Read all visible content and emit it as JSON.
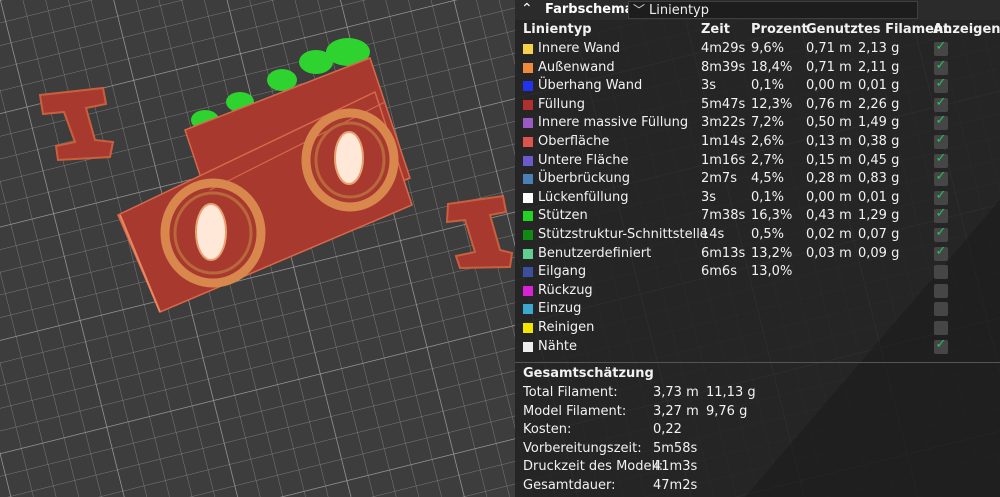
{
  "header": {
    "title": "Farbschema",
    "dropdown_value": "Linientyp"
  },
  "columns": {
    "type": "Linientyp",
    "time": "Zeit",
    "percent": "Prozent",
    "filament": "Genutztes Filament",
    "show": "Anzeigen"
  },
  "rows": [
    {
      "name": "Innere Wand",
      "color": "#f5d24a",
      "time": "4m29s",
      "percent": "9,6%",
      "length": "0,71 m",
      "weight": "2,13 g",
      "show": true
    },
    {
      "name": "Außenwand",
      "color": "#f08a3c",
      "time": "8m39s",
      "percent": "18,4%",
      "length": "0,71 m",
      "weight": "2,11 g",
      "show": true
    },
    {
      "name": "Überhang Wand",
      "color": "#2233ee",
      "time": "3s",
      "percent": "0,1%",
      "length": "0,00 m",
      "weight": "0,01 g",
      "show": true
    },
    {
      "name": "Füllung",
      "color": "#b03030",
      "time": "5m47s",
      "percent": "12,3%",
      "length": "0,76 m",
      "weight": "2,26 g",
      "show": true
    },
    {
      "name": "Innere massive Füllung",
      "color": "#9b59c6",
      "time": "3m22s",
      "percent": "7,2%",
      "length": "0,50 m",
      "weight": "1,49 g",
      "show": true
    },
    {
      "name": "Oberfläche",
      "color": "#e0534c",
      "time": "1m14s",
      "percent": "2,6%",
      "length": "0,13 m",
      "weight": "0,38 g",
      "show": true
    },
    {
      "name": "Untere Fläche",
      "color": "#6a5acd",
      "time": "1m16s",
      "percent": "2,7%",
      "length": "0,15 m",
      "weight": "0,45 g",
      "show": true
    },
    {
      "name": "Überbrückung",
      "color": "#4a7fb8",
      "time": "2m7s",
      "percent": "4,5%",
      "length": "0,28 m",
      "weight": "0,83 g",
      "show": true
    },
    {
      "name": "Lückenfüllung",
      "color": "#ffffff",
      "time": "3s",
      "percent": "0,1%",
      "length": "0,00 m",
      "weight": "0,01 g",
      "show": true
    },
    {
      "name": "Stützen",
      "color": "#22d322",
      "time": "7m38s",
      "percent": "16,3%",
      "length": "0,43 m",
      "weight": "1,29 g",
      "show": true
    },
    {
      "name": "Stützstruktur-Schnittstelle",
      "color": "#108a10",
      "time": "14s",
      "percent": "0,5%",
      "length": "0,02 m",
      "weight": "0,07 g",
      "show": true
    },
    {
      "name": "Benutzerdefiniert",
      "color": "#5ecf8f",
      "time": "6m13s",
      "percent": "13,2%",
      "length": "0,03 m",
      "weight": "0,09 g",
      "show": true
    },
    {
      "name": "Eilgang",
      "color": "#3a4f9e",
      "time": "6m6s",
      "percent": "13,0%",
      "length": "",
      "weight": "",
      "show": false
    },
    {
      "name": "Rückzug",
      "color": "#d822d8",
      "time": "",
      "percent": "",
      "length": "",
      "weight": "",
      "show": false
    },
    {
      "name": "Einzug",
      "color": "#3aa9d0",
      "time": "",
      "percent": "",
      "length": "",
      "weight": "",
      "show": false
    },
    {
      "name": "Reinigen",
      "color": "#f2e500",
      "time": "",
      "percent": "",
      "length": "",
      "weight": "",
      "show": false
    },
    {
      "name": "Nähte",
      "color": "#eeeeee",
      "time": "",
      "percent": "",
      "length": "",
      "weight": "",
      "show": true
    }
  ],
  "summary": {
    "title": "Gesamtschätzung",
    "items": [
      {
        "label": "Total Filament:",
        "v1": "3,73 m",
        "v2": "11,13 g"
      },
      {
        "label": "Model Filament:",
        "v1": "3,27 m",
        "v2": "9,76 g"
      },
      {
        "label": "Kosten:",
        "v1": "0,22",
        "v2": ""
      },
      {
        "label": "Vorbereitungszeit:",
        "v1": "5m58s",
        "v2": ""
      },
      {
        "label": "Druckzeit des Modell:",
        "v1": "41m3s",
        "v2": ""
      },
      {
        "label": "Gesamtdauer:",
        "v1": "47m2s",
        "v2": ""
      }
    ]
  }
}
